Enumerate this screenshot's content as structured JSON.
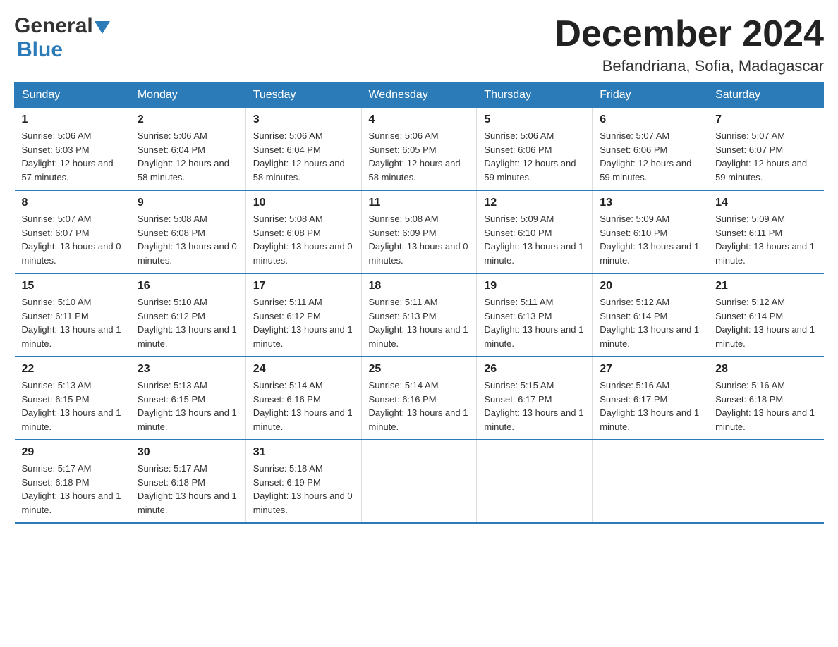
{
  "header": {
    "logo_general": "General",
    "logo_blue": "Blue",
    "month_title": "December 2024",
    "location": "Befandriana, Sofia, Madagascar"
  },
  "days_of_week": [
    "Sunday",
    "Monday",
    "Tuesday",
    "Wednesday",
    "Thursday",
    "Friday",
    "Saturday"
  ],
  "weeks": [
    [
      {
        "day": "1",
        "sunrise": "5:06 AM",
        "sunset": "6:03 PM",
        "daylight": "12 hours and 57 minutes."
      },
      {
        "day": "2",
        "sunrise": "5:06 AM",
        "sunset": "6:04 PM",
        "daylight": "12 hours and 58 minutes."
      },
      {
        "day": "3",
        "sunrise": "5:06 AM",
        "sunset": "6:04 PM",
        "daylight": "12 hours and 58 minutes."
      },
      {
        "day": "4",
        "sunrise": "5:06 AM",
        "sunset": "6:05 PM",
        "daylight": "12 hours and 58 minutes."
      },
      {
        "day": "5",
        "sunrise": "5:06 AM",
        "sunset": "6:06 PM",
        "daylight": "12 hours and 59 minutes."
      },
      {
        "day": "6",
        "sunrise": "5:07 AM",
        "sunset": "6:06 PM",
        "daylight": "12 hours and 59 minutes."
      },
      {
        "day": "7",
        "sunrise": "5:07 AM",
        "sunset": "6:07 PM",
        "daylight": "12 hours and 59 minutes."
      }
    ],
    [
      {
        "day": "8",
        "sunrise": "5:07 AM",
        "sunset": "6:07 PM",
        "daylight": "13 hours and 0 minutes."
      },
      {
        "day": "9",
        "sunrise": "5:08 AM",
        "sunset": "6:08 PM",
        "daylight": "13 hours and 0 minutes."
      },
      {
        "day": "10",
        "sunrise": "5:08 AM",
        "sunset": "6:08 PM",
        "daylight": "13 hours and 0 minutes."
      },
      {
        "day": "11",
        "sunrise": "5:08 AM",
        "sunset": "6:09 PM",
        "daylight": "13 hours and 0 minutes."
      },
      {
        "day": "12",
        "sunrise": "5:09 AM",
        "sunset": "6:10 PM",
        "daylight": "13 hours and 1 minute."
      },
      {
        "day": "13",
        "sunrise": "5:09 AM",
        "sunset": "6:10 PM",
        "daylight": "13 hours and 1 minute."
      },
      {
        "day": "14",
        "sunrise": "5:09 AM",
        "sunset": "6:11 PM",
        "daylight": "13 hours and 1 minute."
      }
    ],
    [
      {
        "day": "15",
        "sunrise": "5:10 AM",
        "sunset": "6:11 PM",
        "daylight": "13 hours and 1 minute."
      },
      {
        "day": "16",
        "sunrise": "5:10 AM",
        "sunset": "6:12 PM",
        "daylight": "13 hours and 1 minute."
      },
      {
        "day": "17",
        "sunrise": "5:11 AM",
        "sunset": "6:12 PM",
        "daylight": "13 hours and 1 minute."
      },
      {
        "day": "18",
        "sunrise": "5:11 AM",
        "sunset": "6:13 PM",
        "daylight": "13 hours and 1 minute."
      },
      {
        "day": "19",
        "sunrise": "5:11 AM",
        "sunset": "6:13 PM",
        "daylight": "13 hours and 1 minute."
      },
      {
        "day": "20",
        "sunrise": "5:12 AM",
        "sunset": "6:14 PM",
        "daylight": "13 hours and 1 minute."
      },
      {
        "day": "21",
        "sunrise": "5:12 AM",
        "sunset": "6:14 PM",
        "daylight": "13 hours and 1 minute."
      }
    ],
    [
      {
        "day": "22",
        "sunrise": "5:13 AM",
        "sunset": "6:15 PM",
        "daylight": "13 hours and 1 minute."
      },
      {
        "day": "23",
        "sunrise": "5:13 AM",
        "sunset": "6:15 PM",
        "daylight": "13 hours and 1 minute."
      },
      {
        "day": "24",
        "sunrise": "5:14 AM",
        "sunset": "6:16 PM",
        "daylight": "13 hours and 1 minute."
      },
      {
        "day": "25",
        "sunrise": "5:14 AM",
        "sunset": "6:16 PM",
        "daylight": "13 hours and 1 minute."
      },
      {
        "day": "26",
        "sunrise": "5:15 AM",
        "sunset": "6:17 PM",
        "daylight": "13 hours and 1 minute."
      },
      {
        "day": "27",
        "sunrise": "5:16 AM",
        "sunset": "6:17 PM",
        "daylight": "13 hours and 1 minute."
      },
      {
        "day": "28",
        "sunrise": "5:16 AM",
        "sunset": "6:18 PM",
        "daylight": "13 hours and 1 minute."
      }
    ],
    [
      {
        "day": "29",
        "sunrise": "5:17 AM",
        "sunset": "6:18 PM",
        "daylight": "13 hours and 1 minute."
      },
      {
        "day": "30",
        "sunrise": "5:17 AM",
        "sunset": "6:18 PM",
        "daylight": "13 hours and 1 minute."
      },
      {
        "day": "31",
        "sunrise": "5:18 AM",
        "sunset": "6:19 PM",
        "daylight": "13 hours and 0 minutes."
      },
      null,
      null,
      null,
      null
    ]
  ],
  "labels": {
    "sunrise": "Sunrise:",
    "sunset": "Sunset:",
    "daylight": "Daylight:"
  }
}
